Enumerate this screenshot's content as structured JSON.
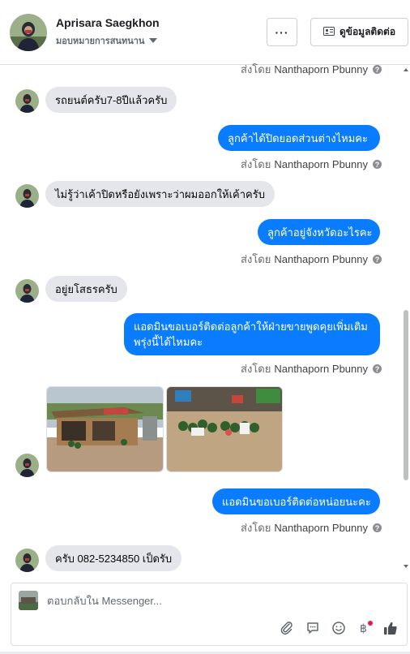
{
  "header": {
    "name": "Aprisara Saegkhon",
    "subtitle": "มอบหมายการสนทนาน",
    "more_label": "···",
    "contact_label": "ดูข้อมูลติดต่อ"
  },
  "thread": {
    "sent_by_prefix": "ส่งโดย",
    "sender": "Nanthaporn Pbunny",
    "info_glyph": "?",
    "messages": [
      {
        "dir": "in",
        "text": "รถยนต์ครับ7-8ปีแล้วครับ"
      },
      {
        "dir": "out",
        "text": "ลูกค้าได้ปิดยอดส่วนต่างไหมคะ"
      },
      {
        "dir": "in",
        "text": "ไม่รู้ว่าเค้าปิดหรือยังเพราะว่าผมออกให้เค้าครับ"
      },
      {
        "dir": "out",
        "text": "ลูกค้าอยู่จังหวัดอะไรคะ"
      },
      {
        "dir": "in",
        "text": "อยู่ยโสธรครับ"
      },
      {
        "dir": "out",
        "text": "แอดมินขอเบอร์ติดต่อลูกค้าให้ฝ่ายขายพูดคุยเพิ่มเติมพรุ่งนี้ได้ไหมคะ"
      },
      {
        "dir": "in",
        "type": "photos",
        "photos": [
          "roadside-fruit-stand-photo",
          "watermelons-on-ground-photo"
        ]
      },
      {
        "dir": "out",
        "text": "แอดมินขอเบอร์ติดต่อหน่อยนะคะ"
      },
      {
        "dir": "in",
        "text": "ครับ 082-5234850 เป็ดรับ"
      }
    ]
  },
  "composer": {
    "placeholder": "ตอบกลับใน Messenger...",
    "tools": [
      "paperclip-icon",
      "chat-bubble-icon",
      "smiley-icon",
      "baht-icon",
      "thumbs-up-icon"
    ]
  },
  "colors": {
    "outgoing_bubble": "#0a7cff",
    "incoming_bubble": "#e4e6eb",
    "notification_dot": "#e41e3f"
  }
}
